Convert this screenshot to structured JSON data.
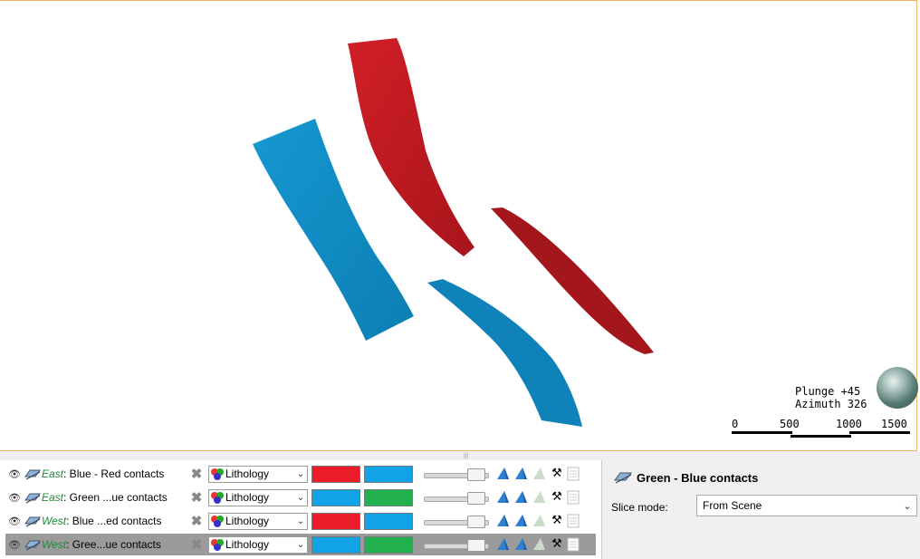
{
  "viewport": {
    "orientation": {
      "plunge": "Plunge +45",
      "azimuth": "Azimuth 326"
    },
    "scale": {
      "labels": [
        "0",
        "500",
        "1000",
        "1500"
      ]
    },
    "colors": {
      "red": "#c91a22",
      "darkred": "#9e1419",
      "blue": "#138fc5",
      "darkblue": "#0a6e9c"
    }
  },
  "layers": {
    "rows": [
      {
        "group": "East",
        "name": ": Blue - Red contacts",
        "lithology": "Lithology",
        "color1": "#ec1c2a",
        "color2": "#12a3e6",
        "selected": false
      },
      {
        "group": "East",
        "name": ": Green ...ue contacts",
        "lithology": "Lithology",
        "color1": "#12a3e6",
        "color2": "#21b14f",
        "selected": false
      },
      {
        "group": "West",
        "name": ": Blue ...ed contacts",
        "lithology": "Lithology",
        "color1": "#ec1c2a",
        "color2": "#12a3e6",
        "selected": false
      },
      {
        "group": "West",
        "name": ": Gree...ue contacts",
        "lithology": "Lithology",
        "color1": "#12a3e6",
        "color2": "#21b14f",
        "selected": true
      }
    ]
  },
  "properties": {
    "title": "Green - Blue contacts",
    "slice_mode_label": "Slice mode:",
    "slice_mode_value": "From Scene"
  }
}
